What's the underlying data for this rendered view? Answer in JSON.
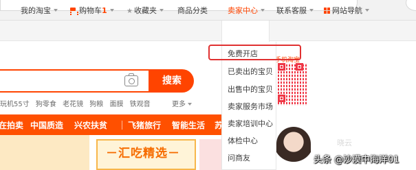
{
  "nav": {
    "my_taobao": "我的淘宝",
    "cart_label": "购物车",
    "cart_count": "1",
    "favorites": "收藏夹",
    "categories": "商品分类",
    "seller_center": "卖家中心",
    "support": "联系客服",
    "site_nav": "网站导航"
  },
  "search": {
    "button_label": "搜索"
  },
  "hotwords": [
    "玩机55寸",
    "狗零食",
    "老花镜",
    "狗粮",
    "面膜",
    "铁观音"
  ],
  "more_label": "更多",
  "category_bar": [
    "在拍卖",
    "中国质造",
    "兴农扶贫",
    "飞猪旅行",
    "智能生活",
    "苏"
  ],
  "banner": {
    "text": "－汇吃精选－"
  },
  "seller_menu": {
    "items": [
      "免费开店",
      "已卖出的宝贝",
      "出售中的宝贝",
      "卖家服务市场",
      "卖家培训中心",
      "体检中心",
      "问商友"
    ]
  },
  "qr": {
    "label": "手机淘宝"
  },
  "watermark": {
    "text": "头条 @沙漠中海洋01",
    "faint": "晓云"
  },
  "colors": {
    "accent": "#ff4400",
    "highlight_border": "#e03030"
  }
}
